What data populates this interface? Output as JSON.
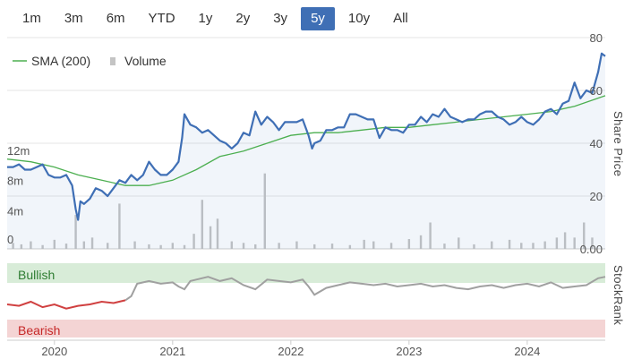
{
  "range_selector": {
    "items": [
      "1m",
      "3m",
      "6m",
      "YTD",
      "1y",
      "2y",
      "3y",
      "5y",
      "10y",
      "All"
    ],
    "selected": "5y",
    "accent": "#3f6fb5"
  },
  "legend": {
    "sma_label": "SMA (200)",
    "volume_label": "Volume"
  },
  "bands": {
    "bullish_label": "Bullish",
    "bearish_label": "Bearish",
    "bullish_color": "#d8ecd8",
    "bearish_color": "#f4d4d4"
  },
  "chart_data": {
    "type": "line",
    "x_ticks": [
      "2020",
      "2021",
      "2022",
      "2023",
      "2024"
    ],
    "x_range": [
      2019.6,
      2024.66
    ],
    "share_price_axis": {
      "label": "Share Price",
      "ticks": [
        "80",
        "60",
        "40",
        "20",
        "0.00"
      ],
      "ylim": [
        0,
        80
      ]
    },
    "volume_axis": {
      "ticks": [
        "12m",
        "8m",
        "4m",
        "0"
      ],
      "ylim": [
        0,
        14
      ]
    },
    "stockrank_axis": {
      "label": "StockRank"
    },
    "series": [
      {
        "name": "Share Price",
        "color": "#3f6fb5",
        "x": [
          2019.6,
          2019.65,
          2019.7,
          2019.75,
          2019.8,
          2019.85,
          2019.9,
          2019.95,
          2020.0,
          2020.05,
          2020.1,
          2020.15,
          2020.18,
          2020.2,
          2020.22,
          2020.25,
          2020.3,
          2020.35,
          2020.4,
          2020.45,
          2020.5,
          2020.55,
          2020.6,
          2020.65,
          2020.7,
          2020.75,
          2020.8,
          2020.85,
          2020.9,
          2020.95,
          2021.0,
          2021.05,
          2021.08,
          2021.1,
          2021.15,
          2021.2,
          2021.25,
          2021.3,
          2021.35,
          2021.4,
          2021.45,
          2021.5,
          2021.55,
          2021.6,
          2021.65,
          2021.7,
          2021.75,
          2021.8,
          2021.85,
          2021.9,
          2021.95,
          2022.0,
          2022.05,
          2022.1,
          2022.15,
          2022.18,
          2022.2,
          2022.25,
          2022.3,
          2022.35,
          2022.4,
          2022.45,
          2022.5,
          2022.55,
          2022.6,
          2022.65,
          2022.7,
          2022.75,
          2022.8,
          2022.85,
          2022.9,
          2022.95,
          2023.0,
          2023.05,
          2023.1,
          2023.15,
          2023.2,
          2023.25,
          2023.3,
          2023.35,
          2023.4,
          2023.45,
          2023.5,
          2023.55,
          2023.6,
          2023.65,
          2023.7,
          2023.75,
          2023.8,
          2023.85,
          2023.9,
          2023.95,
          2024.0,
          2024.05,
          2024.1,
          2024.15,
          2024.2,
          2024.25,
          2024.3,
          2024.35,
          2024.4,
          2024.45,
          2024.5,
          2024.55,
          2024.6,
          2024.63,
          2024.66
        ],
        "y": [
          31,
          31,
          32,
          30,
          30,
          31,
          32,
          28,
          27,
          27,
          28,
          24,
          15,
          11,
          18,
          17,
          19,
          23,
          22,
          20,
          23,
          26,
          25,
          28,
          26,
          28,
          33,
          30,
          28,
          28,
          30,
          33,
          42,
          51,
          47,
          46,
          44,
          45,
          43,
          41,
          40,
          38,
          40,
          44,
          43,
          52,
          47,
          50,
          48,
          45,
          48,
          48,
          48,
          49,
          43,
          38,
          40,
          41,
          45,
          45,
          46,
          46,
          51,
          51,
          50,
          49,
          49,
          42,
          46,
          45,
          45,
          44,
          47,
          47,
          50,
          48,
          51,
          50,
          53,
          50,
          49,
          48,
          49,
          49,
          51,
          52,
          52,
          50,
          49,
          47,
          48,
          50,
          48,
          47,
          49,
          52,
          53,
          51,
          55,
          56,
          63,
          57,
          60,
          59,
          67,
          74,
          73
        ]
      },
      {
        "name": "SMA (200)",
        "color": "#4caf50",
        "x": [
          2019.6,
          2019.8,
          2020.0,
          2020.2,
          2020.4,
          2020.6,
          2020.8,
          2021.0,
          2021.2,
          2021.4,
          2021.6,
          2021.8,
          2022.0,
          2022.2,
          2022.4,
          2022.6,
          2022.8,
          2023.0,
          2023.2,
          2023.4,
          2023.6,
          2023.8,
          2024.0,
          2024.2,
          2024.4,
          2024.66
        ],
        "y": [
          34,
          33,
          31,
          28,
          26,
          24,
          24,
          26,
          30,
          35,
          37,
          40,
          43,
          44,
          44,
          45,
          46,
          46,
          47,
          48,
          49,
          50,
          51,
          52,
          54,
          58
        ]
      },
      {
        "name": "Volume",
        "color": "#c4c4c4",
        "x": [
          2019.65,
          2019.72,
          2019.8,
          2019.9,
          2020.0,
          2020.1,
          2020.18,
          2020.25,
          2020.32,
          2020.45,
          2020.55,
          2020.68,
          2020.8,
          2020.9,
          2021.0,
          2021.1,
          2021.18,
          2021.25,
          2021.32,
          2021.38,
          2021.5,
          2021.6,
          2021.7,
          2021.78,
          2021.9,
          2022.05,
          2022.2,
          2022.35,
          2022.5,
          2022.62,
          2022.7,
          2022.85,
          2023.0,
          2023.1,
          2023.18,
          2023.3,
          2023.42,
          2023.55,
          2023.7,
          2023.85,
          2023.95,
          2024.05,
          2024.15,
          2024.25,
          2024.32,
          2024.4,
          2024.48,
          2024.55
        ],
        "y": [
          0.8,
          0.6,
          1.0,
          0.5,
          1.2,
          0.7,
          4.5,
          1.0,
          1.5,
          0.8,
          6.0,
          1.0,
          0.6,
          0.5,
          0.8,
          0.5,
          2.0,
          6.5,
          3.0,
          4.0,
          1.0,
          0.8,
          0.6,
          10.0,
          0.8,
          1.0,
          0.6,
          0.7,
          0.5,
          1.2,
          1.0,
          0.8,
          1.3,
          1.8,
          3.5,
          0.7,
          1.5,
          0.6,
          1.0,
          1.2,
          0.8,
          0.8,
          1.0,
          1.5,
          2.2,
          1.5,
          3.5,
          1.5
        ]
      },
      {
        "name": "StockRank",
        "color": "#a0a0a0",
        "x": [
          2019.6,
          2019.7,
          2019.8,
          2019.9,
          2020.0,
          2020.1,
          2020.2,
          2020.3,
          2020.4,
          2020.5,
          2020.6,
          2020.65,
          2020.7,
          2020.8,
          2020.9,
          2021.0,
          2021.05,
          2021.1,
          2021.15,
          2021.2,
          2021.3,
          2021.4,
          2021.5,
          2021.6,
          2021.7,
          2021.8,
          2021.9,
          2022.0,
          2022.1,
          2022.15,
          2022.2,
          2022.3,
          2022.4,
          2022.5,
          2022.6,
          2022.7,
          2022.8,
          2022.9,
          2023.0,
          2023.1,
          2023.2,
          2023.3,
          2023.4,
          2023.5,
          2023.6,
          2023.7,
          2023.8,
          2023.9,
          2024.0,
          2024.1,
          2024.2,
          2024.3,
          2024.4,
          2024.5,
          2024.6,
          2024.66
        ],
        "y": [
          48,
          46,
          52,
          44,
          48,
          42,
          46,
          48,
          52,
          50,
          54,
          60,
          78,
          82,
          78,
          80,
          74,
          70,
          82,
          84,
          88,
          82,
          86,
          76,
          70,
          84,
          82,
          80,
          84,
          74,
          62,
          72,
          76,
          80,
          78,
          76,
          78,
          74,
          76,
          78,
          74,
          76,
          72,
          70,
          74,
          76,
          72,
          76,
          78,
          74,
          80,
          72,
          74,
          76,
          86,
          88
        ]
      }
    ],
    "stockrank_ylim": [
      0,
      100
    ],
    "stockrank_threshold": 50
  }
}
